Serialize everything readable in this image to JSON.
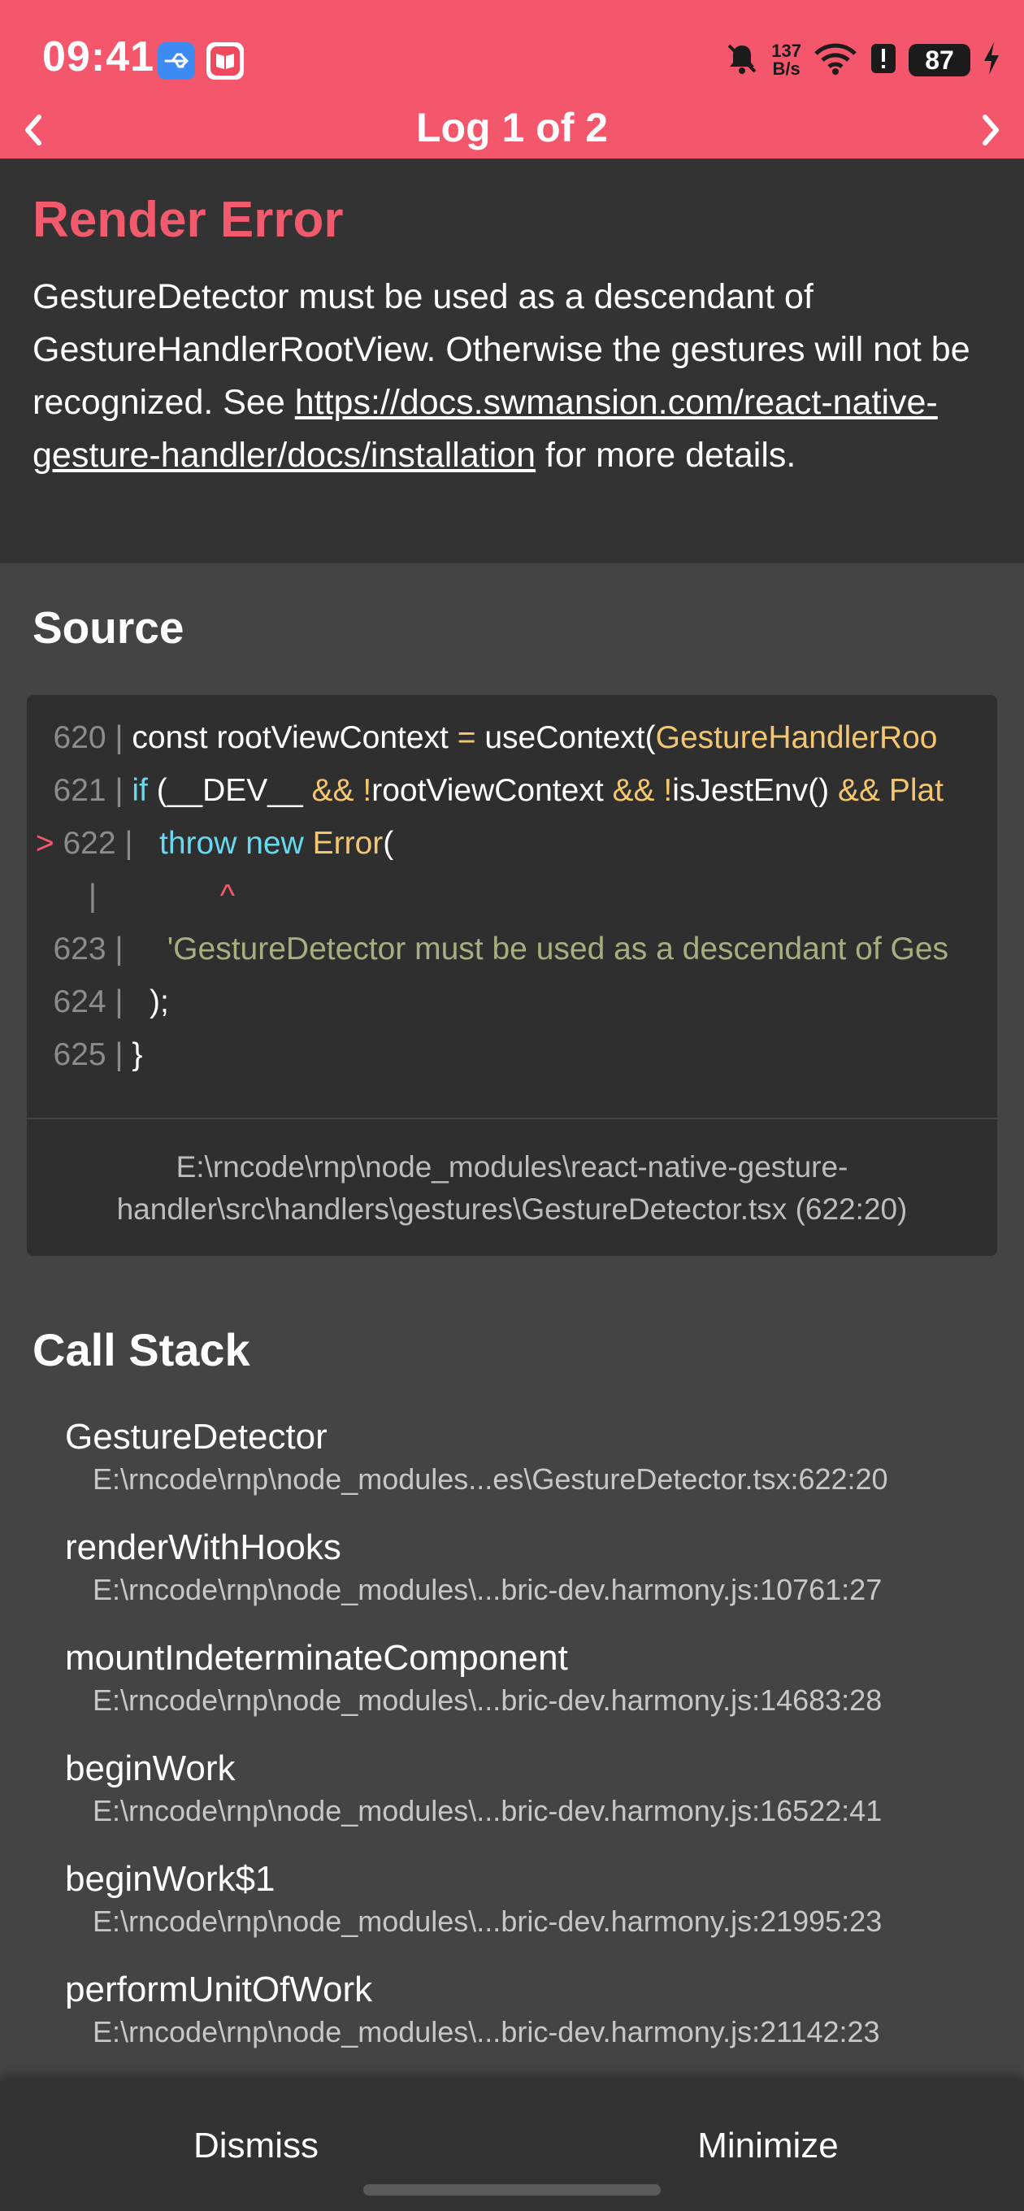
{
  "status_bar": {
    "time": "09:41",
    "net_speed_value": "137",
    "net_speed_unit": "B/s",
    "battery": "87",
    "icons": [
      "usb-icon",
      "book-app-icon",
      "mute-bell-icon",
      "wifi-icon",
      "alert-icon",
      "battery-icon",
      "charging-bolt-icon"
    ]
  },
  "nav": {
    "title": "Log 1 of 2"
  },
  "error": {
    "title": "Render Error",
    "message_prefix": "GestureDetector must be used as a descendant of GestureHandlerRootView. Otherwise the gestures will not be recognized. See ",
    "link": "https://docs.swmansion.com/react-native-gesture-handler/docs/installation",
    "message_suffix": " for more details."
  },
  "source": {
    "heading": "Source",
    "lines": [
      {
        "marker": " ",
        "num": "620",
        "seg": [
          [
            "const ",
            "plain"
          ],
          [
            "rootViewContext ",
            "plain"
          ],
          [
            "= ",
            "yl"
          ],
          [
            "useContext(",
            "plain"
          ],
          [
            "GestureHandlerRoo",
            "yl"
          ]
        ]
      },
      {
        "marker": " ",
        "num": "621",
        "seg": [
          [
            "if ",
            "kw"
          ],
          [
            "(__DEV__ ",
            "plain"
          ],
          [
            "&& ",
            "yl"
          ],
          [
            "!",
            "yl"
          ],
          [
            "rootViewContext ",
            "plain"
          ],
          [
            "&& ",
            "yl"
          ],
          [
            "!",
            "yl"
          ],
          [
            "isJestEnv() ",
            "plain"
          ],
          [
            "&& ",
            "yl"
          ],
          [
            "Plat",
            "yl"
          ]
        ]
      },
      {
        "marker": ">",
        "num": "622",
        "seg": [
          [
            "  throw ",
            "kw"
          ],
          [
            "new ",
            "kw"
          ],
          [
            "Error",
            "yl"
          ],
          [
            "(",
            "plain"
          ]
        ]
      },
      {
        "marker": " ",
        "num": "",
        "seg": [
          [
            "             ^",
            "pk"
          ]
        ]
      },
      {
        "marker": " ",
        "num": "623",
        "seg": [
          [
            "    'GestureDetector must be used as a descendant of Ges",
            "sg"
          ]
        ]
      },
      {
        "marker": " ",
        "num": "624",
        "seg": [
          [
            "  );",
            "plain"
          ]
        ]
      },
      {
        "marker": " ",
        "num": "625",
        "seg": [
          [
            "}",
            "plain"
          ]
        ]
      }
    ],
    "file": "E:\\rncode\\rnp\\node_modules\\react-native-gesture-handler\\src\\handlers\\gestures\\GestureDetector.tsx (622:20)"
  },
  "call_stack": {
    "heading": "Call Stack",
    "frames": [
      {
        "name": "GestureDetector",
        "location": "E:\\rncode\\rnp\\node_modules...es\\GestureDetector.tsx:622:20"
      },
      {
        "name": "renderWithHooks",
        "location": "E:\\rncode\\rnp\\node_modules\\...bric-dev.harmony.js:10761:27"
      },
      {
        "name": "mountIndeterminateComponent",
        "location": "E:\\rncode\\rnp\\node_modules\\...bric-dev.harmony.js:14683:28"
      },
      {
        "name": "beginWork",
        "location": "E:\\rncode\\rnp\\node_modules\\...bric-dev.harmony.js:16522:41"
      },
      {
        "name": "beginWork$1",
        "location": "E:\\rncode\\rnp\\node_modules\\...bric-dev.harmony.js:21995:23"
      },
      {
        "name": "performUnitOfWork",
        "location": "E:\\rncode\\rnp\\node_modules\\...bric-dev.harmony.js:21142:23"
      }
    ]
  },
  "footer": {
    "dismiss_label": "Dismiss",
    "minimize_label": "Minimize"
  },
  "colors": {
    "accent_pink": "#F4566C",
    "error_title": "#F25A6E",
    "code_keyword": "#66D9EF",
    "code_string": "#A6B07F",
    "code_highlight": "#F4C670",
    "panel_dark": "#333333",
    "background": "#444444"
  }
}
